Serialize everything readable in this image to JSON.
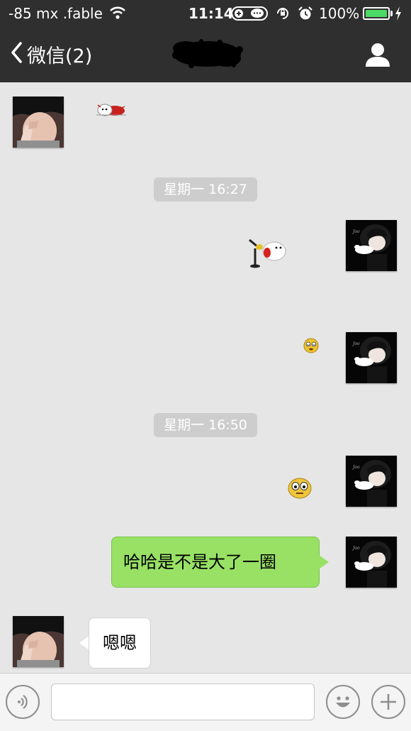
{
  "status_bar": {
    "carrier": "-85 mx .fable",
    "time": "11:14",
    "battery": "100%",
    "battery_level": 1.0,
    "icons": [
      "wifi-icon",
      "link-icon",
      "chat-icon",
      "rotation-lock-icon",
      "alarm-icon",
      "battery-icon",
      "charging-icon"
    ]
  },
  "nav": {
    "back_label": "微信(2)",
    "title_obscured": true,
    "profile_icon": "person-icon"
  },
  "messages": [
    {
      "type": "sticker",
      "side": "left",
      "sticker": "red-mascot-sticker"
    },
    {
      "type": "timestamp",
      "text": "星期一 16:27"
    },
    {
      "type": "sticker",
      "side": "right",
      "sticker": "microphone-sticker"
    },
    {
      "type": "sticker",
      "side": "right",
      "sticker": "dizzy-face-sticker"
    },
    {
      "type": "timestamp",
      "text": "星期一 16:50"
    },
    {
      "type": "sticker",
      "side": "right",
      "sticker": "wide-eyed-face-sticker"
    },
    {
      "type": "text",
      "side": "right",
      "text": "哈哈是不是大了一圈"
    },
    {
      "type": "text",
      "side": "left",
      "text": "嗯嗯"
    }
  ],
  "input_bar": {
    "placeholder": "",
    "value": ""
  },
  "colors": {
    "bar_bg": "#2f2f2f",
    "chat_bg": "#e6e6e6",
    "outgoing_bubble": "#98e165",
    "incoming_bubble": "#ffffff",
    "timestamp_bg": "#cdcdcd",
    "battery_green": "#4cd964"
  }
}
